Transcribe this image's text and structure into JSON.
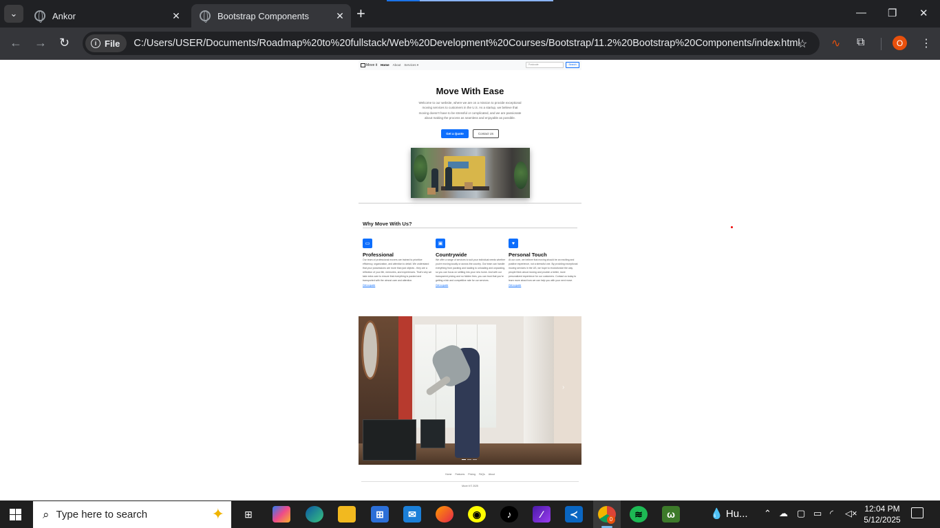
{
  "browser": {
    "tabs": [
      {
        "title": "Ankor",
        "active": false
      },
      {
        "title": "Bootstrap Components",
        "active": true
      }
    ],
    "new_tab_icon": "plus-icon",
    "site_info_label": "File",
    "url": "C:/Users/USER/Documents/Roadmap%20to%20fullstack/Web%20Development%20Courses/Bootstrap/11.2%20Bootstrap%20Components/index.html",
    "profile_initial": "O"
  },
  "page": {
    "navbar": {
      "brand": "Move it",
      "links": [
        "Home",
        "About",
        "Services"
      ],
      "search_placeholder": "Postcode",
      "search_button": "Search"
    },
    "hero": {
      "title": "Move With Ease",
      "lead": "Welcome to our website, where we are on a mission to provide exceptional moving services to customers in the U.S. As a startup, we believe that moving doesn't have to be stressful or complicated, and we are passionate about making the process as seamless and enjoyable as possible.",
      "primary_button": "Get a Quote",
      "secondary_button": "Contact Us"
    },
    "features_title": "Why Move With Us?",
    "features": [
      {
        "icon": "briefcase-icon",
        "title": "Professional",
        "text": "Our team of professional movers are trained to prioritize efficiency, organization, and attention to detail. We understand that your possessions are more than just objects - they are a reflection of your life, memories, and experiences. That's why we take extra care to ensure that everything is packed and transported with the utmost care and attention.",
        "link": "Get a quote"
      },
      {
        "icon": "monitor-icon",
        "title": "Countrywide",
        "text": "We offer a range of services to suit your individual needs whether you're moving locally or across the country. Our team can handle everything from packing and loading to unloading and unpacking, so you can focus on settling into your new home. And with our transparent pricing and no hidden fees, you can trust that you're getting a fair and competitive rate for our services.",
        "link": "Get a quote"
      },
      {
        "icon": "heart-screen-icon",
        "title": "Personal Touch",
        "text": "At our core, we believe that moving should be an exciting and positive experience, not a stressful one. By providing exceptional moving services in the US, we hope to revolutionize the way people think about moving and provide a better, more personalized experience for our customers. Contact us today to learn more about how we can help you with your next move.",
        "link": "Get a quote"
      }
    ],
    "footer": {
      "links": [
        "Home",
        "Features",
        "Pricing",
        "FAQs",
        "About"
      ],
      "copyright": "Move It © 2025"
    }
  },
  "taskbar": {
    "search_placeholder": "Type here to search",
    "weather_label": "Hu...",
    "time": "12:04 PM",
    "date": "5/12/2025",
    "chrome_badge": "0"
  },
  "colors": {
    "primary": "#0d6efd",
    "chrome_dark": "#202124",
    "chrome_toolbar": "#35363a",
    "taskbar": "#1f1f1f"
  }
}
